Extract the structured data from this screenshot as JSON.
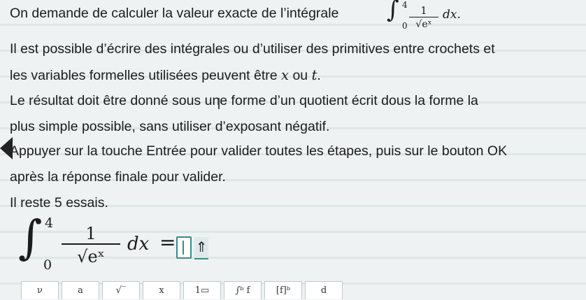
{
  "question": {
    "line1": "On demande de calculer la valeur exacte de l’intégrale",
    "integral": {
      "lower": "0",
      "upper": "4",
      "numerator": "1",
      "denominator": "√eˣ",
      "dx": "dx."
    },
    "para2a": "Il est possible d’écrire des intégrales ou d’utiliser des primitives entre crochets et",
    "para2b_pre": "les variables formelles utilisées peuvent être ",
    "var_x": "x",
    "para2b_mid": " ou ",
    "var_t": "t",
    "para2b_end": ".",
    "para3a": "Le résultat doit être donné sous une forme d’un quotient écrit dous la forme la",
    "para3b": "plus simple possible, sans utiliser d’exposant négatif.",
    "para4a": "Appuyer sur la touche Entrée pour valider toutes les étapes, puis sur le bouton OK",
    "para4b": "après la réponse finale pour valider.",
    "tries": "Il reste 5 essais."
  },
  "answer": {
    "upper": "4",
    "lower": "0",
    "numerator": "1",
    "denominator": "√eˣ",
    "dx": "dx",
    "equals": "=",
    "submit_symbol": "⇑"
  },
  "toolbar": {
    "buttons": [
      "ν",
      "a",
      "√‾",
      "x",
      "1▭",
      "∫ᵇ f",
      "[f]ᵇ",
      "d"
    ]
  }
}
